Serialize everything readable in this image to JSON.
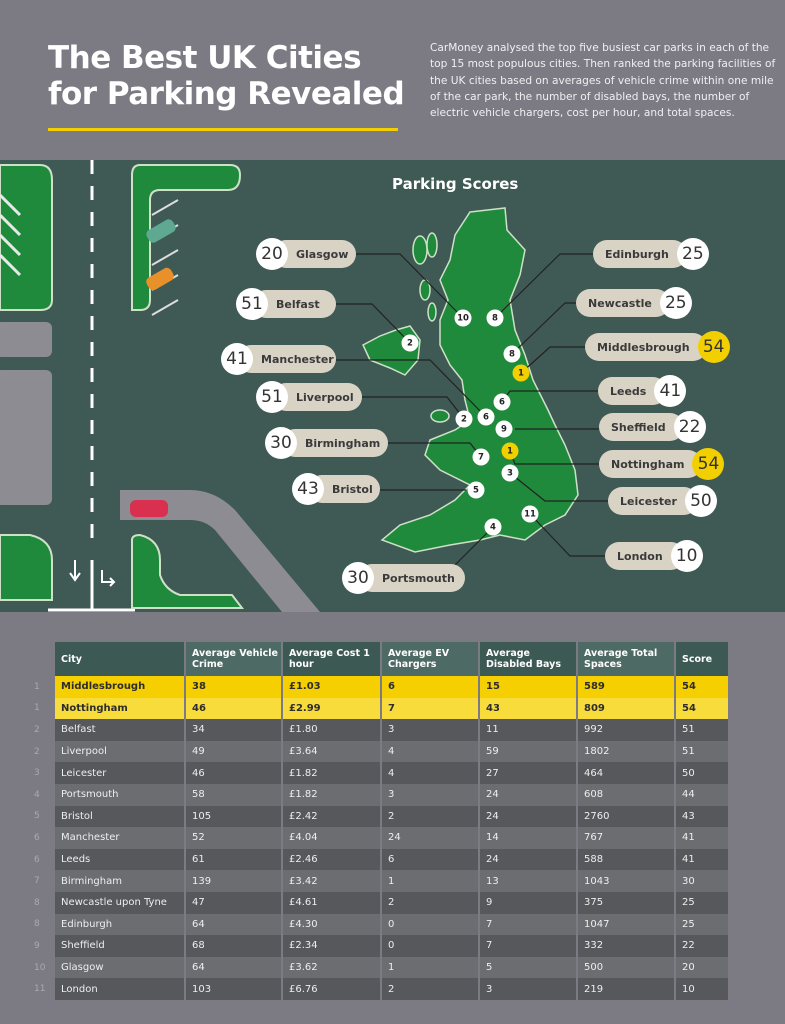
{
  "header": {
    "title": "The Best UK Cities for Parking Revealed",
    "intro": "CarMoney analysed the top five busiest car parks in each of the top 15 most populous cities. Then ranked the parking facilities of the UK cities based on averages of vehicle crime within one mile of the car park, the number of disabled bays, the number of electric vehicle chargers, cost per hour, and total spaces."
  },
  "colors": {
    "accent": "#f2cf00",
    "map_bg": "#3f5a55",
    "land": "#1f8a3b",
    "label_bg": "#d9d3c5",
    "table_header": "#3d5954"
  },
  "map": {
    "title": "Parking Scores",
    "labels": [
      {
        "city": "Glasgow",
        "score": "20"
      },
      {
        "city": "Belfast",
        "score": "51"
      },
      {
        "city": "Manchester",
        "score": "41"
      },
      {
        "city": "Liverpool",
        "score": "51"
      },
      {
        "city": "Birmingham",
        "score": "30"
      },
      {
        "city": "Bristol",
        "score": "43"
      },
      {
        "city": "Portsmouth",
        "score": "30"
      },
      {
        "city": "Edinburgh",
        "score": "25"
      },
      {
        "city": "Newcastle",
        "score": "25"
      },
      {
        "city": "Middlesbrough",
        "score": "54",
        "highlight": true
      },
      {
        "city": "Leeds",
        "score": "41"
      },
      {
        "city": "Sheffield",
        "score": "22"
      },
      {
        "city": "Nottingham",
        "score": "54",
        "highlight": true
      },
      {
        "city": "Leicester",
        "score": "50"
      },
      {
        "city": "London",
        "score": "10"
      }
    ],
    "pins": [
      {
        "city": "Glasgow",
        "rank": "10"
      },
      {
        "city": "Edinburgh",
        "rank": "8"
      },
      {
        "city": "Belfast",
        "rank": "2"
      },
      {
        "city": "Newcastle",
        "rank": "8"
      },
      {
        "city": "Middlesbrough",
        "rank": "1"
      },
      {
        "city": "Leeds",
        "rank": "6"
      },
      {
        "city": "Liverpool",
        "rank": "2"
      },
      {
        "city": "Manchester",
        "rank": "6"
      },
      {
        "city": "Sheffield",
        "rank": "9"
      },
      {
        "city": "Nottingham",
        "rank": "1"
      },
      {
        "city": "Birmingham",
        "rank": "7"
      },
      {
        "city": "Leicester",
        "rank": "3"
      },
      {
        "city": "Bristol",
        "rank": "5"
      },
      {
        "city": "London",
        "rank": "11"
      },
      {
        "city": "Portsmouth",
        "rank": "4"
      }
    ]
  },
  "table": {
    "columns": [
      "City",
      "Average Vehicle Crime",
      "Average Cost 1 hour",
      "Average EV Chargers",
      "Average Disabled Bays",
      "Average Total Spaces",
      "Score"
    ],
    "rows": [
      {
        "rank": "1",
        "cells": [
          "Middlesbrough",
          "38",
          "£1.03",
          "6",
          "15",
          "589",
          "54"
        ]
      },
      {
        "rank": "1",
        "cells": [
          "Nottingham",
          "46",
          "£2.99",
          "7",
          "43",
          "809",
          "54"
        ]
      },
      {
        "rank": "2",
        "cells": [
          "Belfast",
          "34",
          "£1.80",
          "3",
          "11",
          "992",
          "51"
        ]
      },
      {
        "rank": "2",
        "cells": [
          "Liverpool",
          "49",
          "£3.64",
          "4",
          "59",
          "1802",
          "51"
        ]
      },
      {
        "rank": "3",
        "cells": [
          "Leicester",
          "46",
          "£1.82",
          "4",
          "27",
          "464",
          "50"
        ]
      },
      {
        "rank": "4",
        "cells": [
          "Portsmouth",
          "58",
          "£1.82",
          "3",
          "24",
          "608",
          "44"
        ]
      },
      {
        "rank": "5",
        "cells": [
          "Bristol",
          "105",
          "£2.42",
          "2",
          "24",
          "2760",
          "43"
        ]
      },
      {
        "rank": "6",
        "cells": [
          "Manchester",
          "52",
          "£4.04",
          "24",
          "14",
          "767",
          "41"
        ]
      },
      {
        "rank": "6",
        "cells": [
          "Leeds",
          "61",
          "£2.46",
          "6",
          "24",
          "588",
          "41"
        ]
      },
      {
        "rank": "7",
        "cells": [
          "Birmingham",
          "139",
          "£3.42",
          "1",
          "13",
          "1043",
          "30"
        ]
      },
      {
        "rank": "8",
        "cells": [
          "Newcastle upon Tyne",
          "47",
          "£4.61",
          "2",
          "9",
          "375",
          "25"
        ]
      },
      {
        "rank": "8",
        "cells": [
          "Edinburgh",
          "64",
          "£4.30",
          "0",
          "7",
          "1047",
          "25"
        ]
      },
      {
        "rank": "9",
        "cells": [
          "Sheffield",
          "68",
          "£2.34",
          "0",
          "7",
          "332",
          "22"
        ]
      },
      {
        "rank": "10",
        "cells": [
          "Glasgow",
          "64",
          "£3.62",
          "1",
          "5",
          "500",
          "20"
        ]
      },
      {
        "rank": "11",
        "cells": [
          "London",
          "103",
          "£6.76",
          "2",
          "3",
          "219",
          "10"
        ]
      }
    ]
  }
}
